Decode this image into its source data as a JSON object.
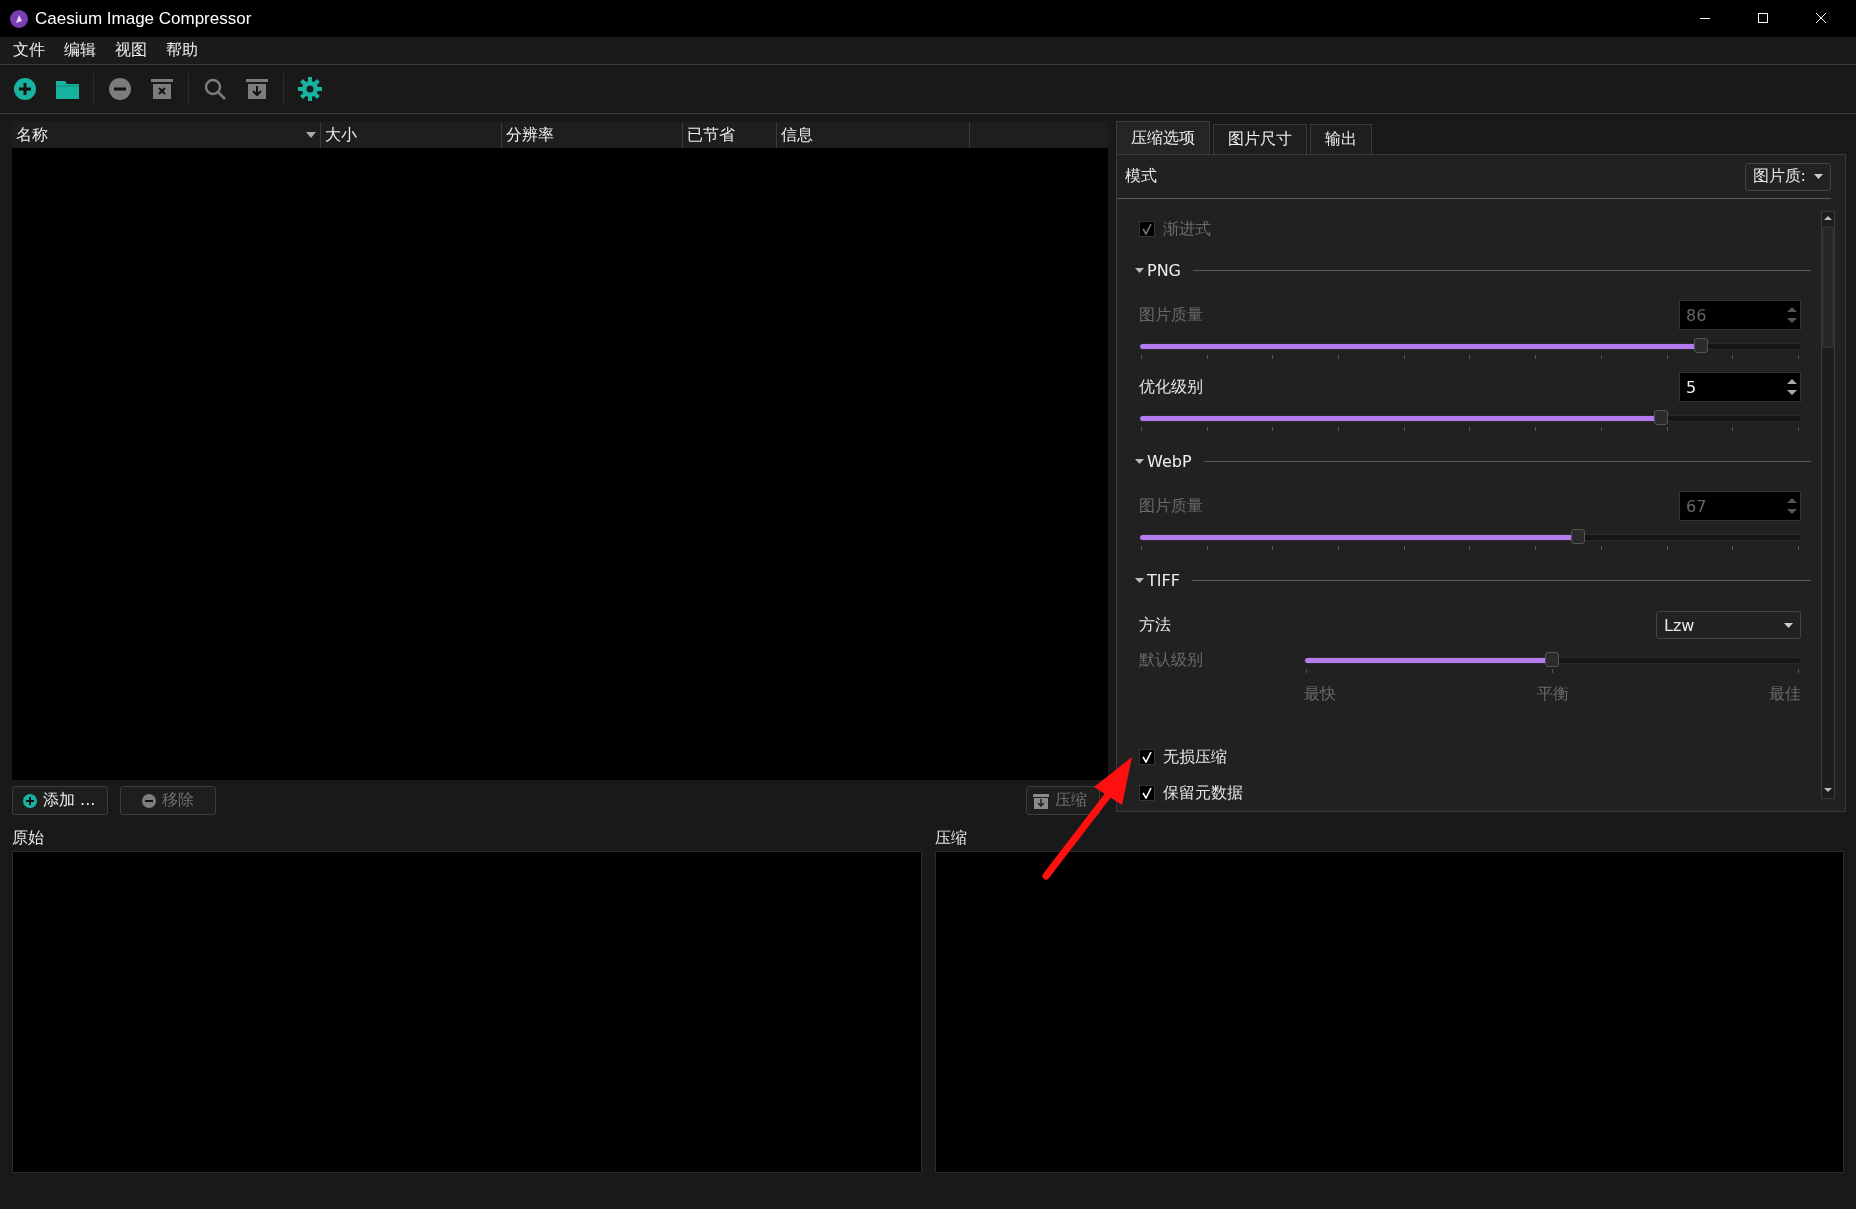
{
  "window": {
    "title": "Caesium Image Compressor"
  },
  "menu": [
    "文件",
    "编辑",
    "视图",
    "帮助"
  ],
  "toolbar": [
    {
      "kind": "add",
      "disabled": false
    },
    {
      "kind": "folder",
      "disabled": false
    },
    {
      "kind": "sep"
    },
    {
      "kind": "remove",
      "disabled": true
    },
    {
      "kind": "clear",
      "disabled": true
    },
    {
      "kind": "sep"
    },
    {
      "kind": "search",
      "disabled": true
    },
    {
      "kind": "export",
      "disabled": true
    },
    {
      "kind": "sep"
    },
    {
      "kind": "settings",
      "disabled": false
    }
  ],
  "table": {
    "columns": [
      {
        "label": "名称",
        "sorted": true
      },
      {
        "label": "大小",
        "sorted": false
      },
      {
        "label": "分辨率",
        "sorted": false
      },
      {
        "label": "已节省",
        "sorted": false
      },
      {
        "label": "信息",
        "sorted": false
      }
    ]
  },
  "list_buttons": [
    {
      "kind": "add",
      "label": "添加 ...",
      "disabled": false
    },
    {
      "kind": "remove",
      "label": "移除",
      "disabled": true
    }
  ],
  "compress_button": {
    "label": "压缩",
    "disabled": true
  },
  "tabs": [
    {
      "label": "压缩选项",
      "selected": true
    },
    {
      "label": "图片尺寸",
      "selected": false
    },
    {
      "label": "输出",
      "selected": false
    }
  ],
  "mode": {
    "label": "模式",
    "value": "图片质:"
  },
  "options": [
    {
      "kind": "checkbox",
      "label": "渐进式",
      "checked": true,
      "disabled": true
    },
    {
      "kind": "section",
      "label": "PNG",
      "expanded": true
    },
    {
      "kind": "spin_slider",
      "label": "图片质量",
      "value": "86",
      "level": 0.85,
      "disabled": true
    },
    {
      "kind": "spin_slider",
      "label": "优化级别",
      "value": "5",
      "level": 0.79,
      "disabled": false
    },
    {
      "kind": "section",
      "label": "WebP",
      "expanded": true
    },
    {
      "kind": "spin_slider",
      "label": "图片质量",
      "value": "67",
      "level": 0.665,
      "disabled": true
    },
    {
      "kind": "section",
      "label": "TIFF",
      "expanded": true
    },
    {
      "kind": "combo",
      "label": "方法",
      "value": "Lzw"
    },
    {
      "kind": "tick_slider",
      "label": "默认级别",
      "level": 0.5,
      "disabled": true,
      "ticks": [
        "最快",
        "平衡",
        "最佳"
      ]
    },
    {
      "kind": "checkbox",
      "label": "无损压缩",
      "checked": true,
      "disabled": false
    },
    {
      "kind": "checkbox",
      "label": "保留元数据",
      "checked": true,
      "disabled": false
    }
  ],
  "previews": [
    {
      "label": "原始"
    },
    {
      "label": "压缩"
    }
  ]
}
